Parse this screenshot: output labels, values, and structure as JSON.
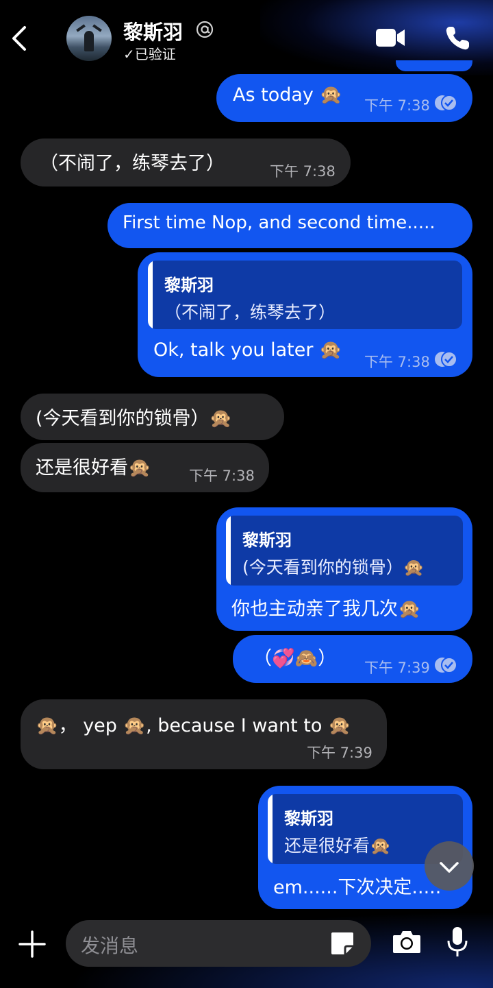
{
  "header": {
    "contact_name": "黎斯羽",
    "verified_label": "✓已验证",
    "icons": [
      "back-chevron-icon",
      "avatar",
      "at-icon",
      "video-call-icon",
      "phone-call-icon"
    ]
  },
  "messages": [
    {
      "id": "m1",
      "dir": "out",
      "text": "As today 🙊",
      "time": "下午 7:38",
      "read": true
    },
    {
      "id": "m2",
      "dir": "in",
      "text": "（不闹了，练琴去了）",
      "time": "下午 7:38"
    },
    {
      "id": "m3",
      "dir": "out",
      "text": "First time Nop, and second time....."
    },
    {
      "id": "m4",
      "dir": "out",
      "quote_name": "黎斯羽",
      "quote_text": "（不闹了，练琴去了）",
      "text": "Ok, talk you later 🙊",
      "time": "下午 7:38",
      "read": true
    },
    {
      "id": "m5",
      "dir": "in",
      "text": "(今天看到你的锁骨）🙊"
    },
    {
      "id": "m6",
      "dir": "in",
      "text": "还是很好看🙊",
      "time": "下午 7:38"
    },
    {
      "id": "m7",
      "dir": "out",
      "quote_name": "黎斯羽",
      "quote_text": "(今天看到你的锁骨）🙊",
      "text": "你也主动亲了我几次🙊"
    },
    {
      "id": "m8",
      "dir": "out",
      "text": "（💞🙈）",
      "time": "下午 7:39",
      "read": true
    },
    {
      "id": "m9",
      "dir": "in",
      "text": "🙊， yep 🙊, because I want to 🙊",
      "time": "下午 7:39"
    },
    {
      "id": "m10",
      "dir": "out",
      "quote_name": "黎斯羽",
      "quote_text": "还是很好看🙊",
      "text": "em......下次决定....."
    }
  ],
  "composer": {
    "placeholder": "发消息",
    "icons": [
      "plus-icon",
      "sticker-icon",
      "camera-icon",
      "microphone-icon"
    ]
  },
  "colors": {
    "outgoing_bubble": "#1256f0",
    "incoming_bubble": "#262628",
    "quote_block": "#0e3aa6",
    "background": "#000000"
  }
}
